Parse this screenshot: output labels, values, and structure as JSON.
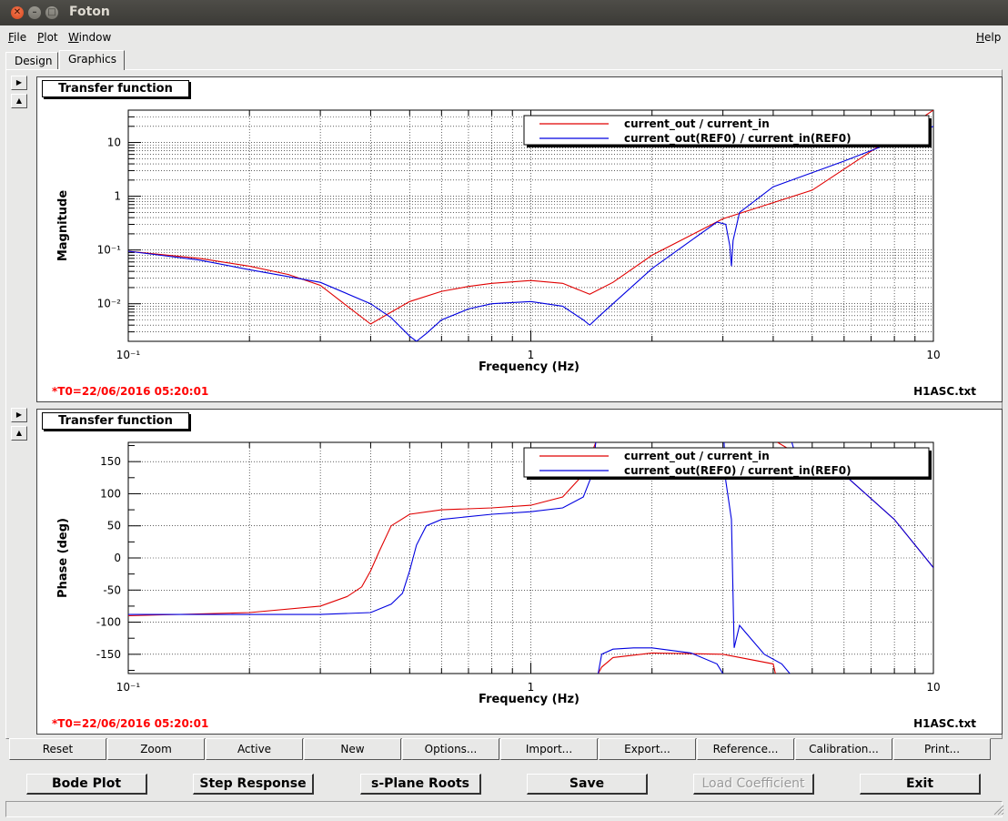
{
  "window": {
    "title": "Foton"
  },
  "menu": {
    "file": "File",
    "plot": "Plot",
    "window": "Window",
    "help": "Help"
  },
  "tabs": {
    "design": "Design",
    "graphics": "Graphics"
  },
  "colors": {
    "trace1": "#e00000",
    "trace2": "#0000e0",
    "stamp": "#ff0000"
  },
  "plots": [
    {
      "title": "Transfer function",
      "ylabel": "Magnitude",
      "xlabel": "Frequency (Hz)",
      "stamp": "*T0=22/06/2016 05:20:01",
      "file": "H1ASC.txt",
      "legend": [
        "current_out / current_in",
        "current_out(REF0) / current_in(REF0)"
      ],
      "xticks": [
        "10⁻¹",
        "1",
        "10"
      ],
      "yticks": [
        "10",
        "1",
        "10⁻¹",
        "10⁻²"
      ]
    },
    {
      "title": "Transfer function",
      "ylabel": "Phase (deg)",
      "xlabel": "Frequency (Hz)",
      "stamp": "*T0=22/06/2016 05:20:01",
      "file": "H1ASC.txt",
      "legend": [
        "current_out / current_in",
        "current_out(REF0) / current_in(REF0)"
      ],
      "xticks": [
        "10⁻¹",
        "1",
        "10"
      ],
      "yticks": [
        "150",
        "100",
        "50",
        "0",
        "-50",
        "-100",
        "-150"
      ]
    }
  ],
  "chart_data": [
    {
      "type": "line",
      "xscale": "log",
      "yscale": "log",
      "xlim": [
        0.1,
        10
      ],
      "ylim": [
        0.002,
        40
      ],
      "grid": true,
      "legend": "top-right",
      "series": [
        {
          "name": "current_out / current_in",
          "x": [
            0.1,
            0.15,
            0.2,
            0.25,
            0.3,
            0.35,
            0.4,
            0.45,
            0.5,
            0.6,
            0.7,
            0.8,
            1.0,
            1.2,
            1.4,
            1.6,
            2.0,
            3.0,
            5.0,
            10.0
          ],
          "y": [
            0.095,
            0.07,
            0.05,
            0.035,
            0.022,
            0.009,
            0.0042,
            0.007,
            0.011,
            0.017,
            0.021,
            0.024,
            0.027,
            0.024,
            0.015,
            0.025,
            0.08,
            0.38,
            1.3,
            40
          ]
        },
        {
          "name": "current_out(REF0) / current_in(REF0)",
          "x": [
            0.1,
            0.15,
            0.2,
            0.3,
            0.4,
            0.45,
            0.5,
            0.52,
            0.55,
            0.6,
            0.7,
            0.8,
            1.0,
            1.2,
            1.35,
            1.4,
            1.5,
            2.0,
            2.5,
            2.9,
            3.05,
            3.12,
            3.15,
            3.18,
            3.3,
            4.0,
            6.0,
            10.0
          ],
          "y": [
            0.095,
            0.065,
            0.043,
            0.025,
            0.01,
            0.0055,
            0.0025,
            0.002,
            0.0028,
            0.005,
            0.008,
            0.01,
            0.011,
            0.009,
            0.005,
            0.004,
            0.0065,
            0.045,
            0.15,
            0.33,
            0.3,
            0.12,
            0.05,
            0.15,
            0.5,
            1.5,
            4.5,
            20
          ]
        }
      ]
    },
    {
      "type": "line",
      "xscale": "log",
      "yscale": "linear",
      "xlim": [
        0.1,
        10
      ],
      "ylim": [
        -180,
        180
      ],
      "grid": true,
      "legend": "top-right",
      "series": [
        {
          "name": "current_out / current_in",
          "x": [
            0.1,
            0.2,
            0.3,
            0.35,
            0.38,
            0.4,
            0.42,
            0.45,
            0.5,
            0.6,
            0.8,
            1.0,
            1.2,
            1.35,
            1.45,
            1.47,
            1.5,
            1.6,
            2.0,
            3.0,
            4.0,
            4.05,
            4.1,
            4.5,
            6.0,
            8.0,
            10.0
          ],
          "y": [
            -90,
            -85,
            -75,
            -60,
            -45,
            -20,
            10,
            50,
            68,
            75,
            78,
            82,
            95,
            130,
            180,
            -180,
            -170,
            -155,
            -148,
            -150,
            -165,
            -180,
            180,
            165,
            130,
            60,
            -15
          ]
        },
        {
          "name": "current_out(REF0) / current_in(REF0)",
          "x": [
            0.1,
            0.3,
            0.4,
            0.45,
            0.48,
            0.5,
            0.52,
            0.55,
            0.6,
            0.8,
            1.0,
            1.2,
            1.35,
            1.42,
            1.45,
            1.47,
            1.5,
            1.6,
            1.8,
            2.0,
            2.5,
            2.9,
            3.0,
            3.02,
            3.05,
            3.15,
            3.2,
            3.3,
            3.8,
            4.2,
            4.4,
            4.45,
            4.5,
            6.0,
            8.0,
            10.0
          ],
          "y": [
            -88,
            -88,
            -85,
            -72,
            -55,
            -20,
            20,
            50,
            60,
            68,
            72,
            78,
            95,
            130,
            180,
            -180,
            -150,
            -142,
            -140,
            -140,
            -148,
            -165,
            -180,
            180,
            120,
            60,
            -140,
            -105,
            -150,
            -165,
            -180,
            180,
            170,
            130,
            60,
            -15
          ]
        }
      ]
    }
  ],
  "toolbar": [
    "Reset",
    "Zoom",
    "Active",
    "New",
    "Options...",
    "Import...",
    "Export...",
    "Reference...",
    "Calibration...",
    "Print..."
  ],
  "buttons": {
    "bode": "Bode Plot",
    "step": "Step Response",
    "splane": "s-Plane Roots",
    "save": "Save",
    "load": "Load Coefficient",
    "exit": "Exit"
  }
}
